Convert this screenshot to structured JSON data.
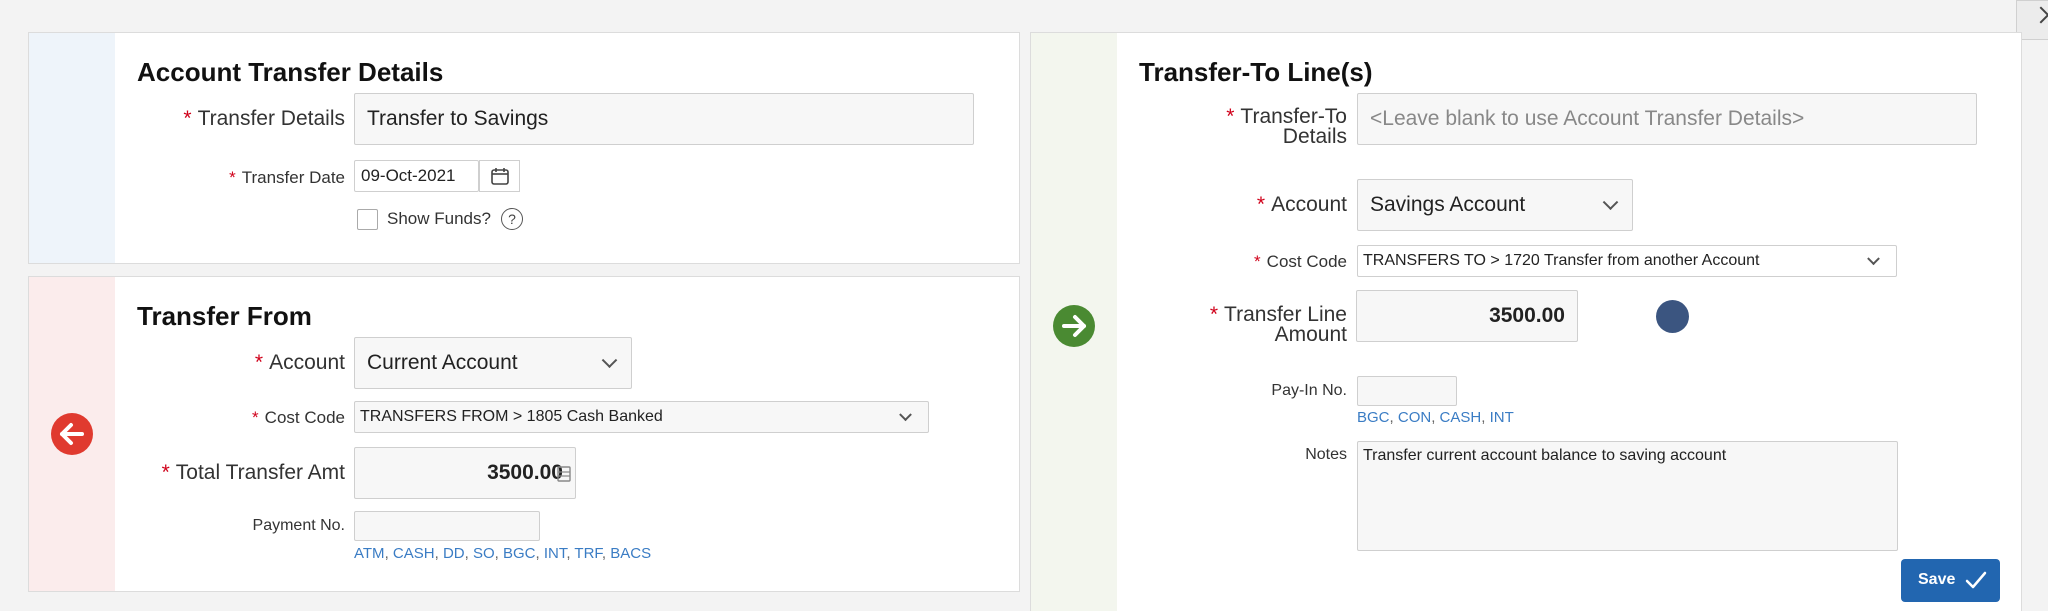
{
  "account_transfer_details": {
    "title": "Account Transfer Details",
    "transfer_details_label": "Transfer Details",
    "transfer_details_value": "Transfer to Savings",
    "transfer_date_label": "Transfer Date",
    "transfer_date_value": "09-Oct-2021",
    "show_funds_label": "Show Funds?",
    "show_funds_checked": false
  },
  "transfer_from": {
    "title": "Transfer From",
    "account_label": "Account",
    "account_value": "Current Account",
    "cost_code_label": "Cost Code",
    "cost_code_value": "TRANSFERS FROM > 1805 Cash Banked",
    "total_label": "Total Transfer Amt",
    "total_value": "3500.00",
    "payment_no_label": "Payment No.",
    "payment_no_value": "",
    "payment_types": [
      "ATM",
      "CASH",
      "DD",
      "SO",
      "BGC",
      "INT",
      "TRF",
      "BACS"
    ]
  },
  "transfer_to": {
    "title": "Transfer-To Line(s)",
    "details_label_line1": "Transfer-To",
    "details_label_line2": "Details",
    "details_placeholder": "<Leave blank to use Account Transfer Details>",
    "account_label": "Account",
    "account_value": "Savings Account",
    "cost_code_label": "Cost Code",
    "cost_code_value": "TRANSFERS TO > 1720 Transfer from another Account",
    "amount_label_line1": "Transfer Line",
    "amount_label_line2": "Amount",
    "amount_value": "3500.00",
    "pay_in_label": "Pay-In No.",
    "pay_in_value": "",
    "pay_in_types": [
      "BGC",
      "CON",
      "CASH",
      "INT"
    ],
    "notes_label": "Notes",
    "notes_value": "Transfer current account balance to saving account"
  },
  "actions": {
    "save_label": "Save"
  },
  "colors": {
    "red": "#e03a2f",
    "green": "#4a8a32",
    "blue_dot": "#3b5580",
    "save_bg": "#2266b0",
    "link": "#3a7cc4"
  }
}
